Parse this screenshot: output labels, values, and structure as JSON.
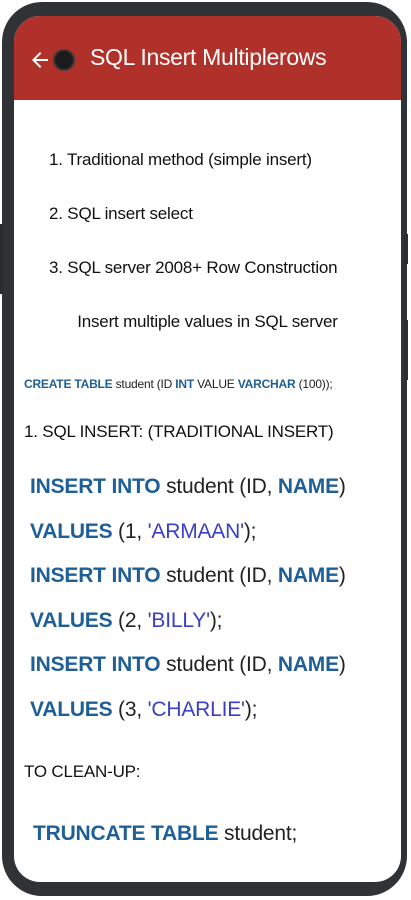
{
  "app": {
    "title": "SQL Insert Multiplerows",
    "back_icon": "arrow-left-icon",
    "accent_color": "#b0302a"
  },
  "methods": [
    "1. Traditional method (simple insert)",
    "2. SQL insert select",
    "3. SQL server 2008+ Row Construction"
  ],
  "subtitle": "Insert multiple values in SQL server",
  "create": {
    "kw1": "CREATE TABLE",
    "t1": " student (ID ",
    "kw2": "INT",
    "t2": " VALUE ",
    "kw3": "VARCHAR",
    "t3": " (100));"
  },
  "section1": "1. SQL INSERT: (TRADITIONAL INSERT)",
  "inserts": [
    {
      "kw": "INSERT INTO",
      "table": " student (ID, ",
      "col": "NAME",
      "close": ")",
      "values_kw": "VALUES",
      "open": " (1, ",
      "value": "'ARMAAN'",
      "end": ");"
    },
    {
      "kw": "INSERT INTO",
      "table": " student (ID, ",
      "col": "NAME",
      "close": ")",
      "values_kw": "VALUES",
      "open": " (2, ",
      "value": "'BILLY'",
      "end": ");"
    },
    {
      "kw": "INSERT INTO",
      "table": " student (ID, ",
      "col": "NAME",
      "close": ")",
      "values_kw": "VALUES",
      "open": " (3, ",
      "value": "'CHARLIE'",
      "end": ");"
    }
  ],
  "cleanup_label": "TO CLEAN-UP:",
  "truncate": {
    "kw": "TRUNCATE TABLE",
    "rest": " student;"
  }
}
